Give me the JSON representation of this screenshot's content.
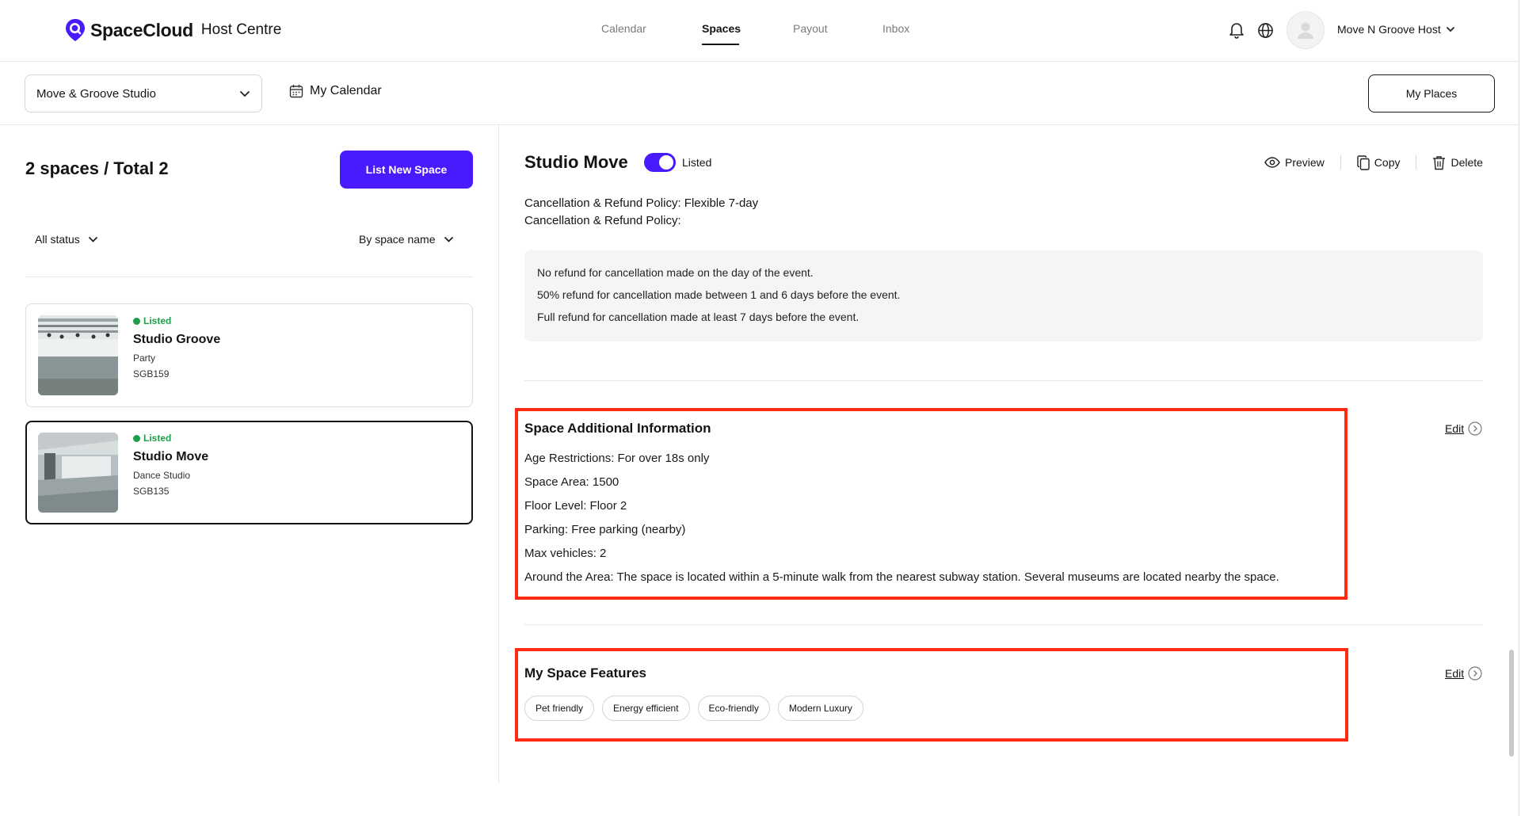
{
  "brand": {
    "name": "SpaceCloud",
    "section": "Host Centre",
    "accent": "#4a1aff"
  },
  "nav": {
    "items": [
      "Calendar",
      "Spaces",
      "Payout",
      "Inbox"
    ],
    "active": "Spaces"
  },
  "user": {
    "name": "Move N Groove Host"
  },
  "subheader": {
    "venue": "Move & Groove Studio",
    "calendar_label": "My Calendar",
    "my_places_label": "My Places"
  },
  "left": {
    "count_label": "2 spaces / Total 2",
    "list_new_label": "List New Space",
    "status_filter": "All status",
    "sort_filter": "By space name",
    "spaces": [
      {
        "status": "Listed",
        "title": "Studio Groove",
        "type": "Party",
        "code": "SGB159"
      },
      {
        "status": "Listed",
        "title": "Studio Move",
        "type": "Dance Studio",
        "code": "SGB135"
      }
    ]
  },
  "detail": {
    "title": "Studio Move",
    "listed_label": "Listed",
    "actions": {
      "preview": "Preview",
      "copy": "Copy",
      "delete": "Delete"
    },
    "policy_line1": "Cancellation & Refund Policy: Flexible 7-day",
    "policy_line2": "Cancellation & Refund Policy:",
    "policy_items": [
      "No refund for cancellation made on the day of the event.",
      "50% refund for cancellation made between 1 and 6 days before the event.",
      "Full refund for cancellation made at least 7 days before the event."
    ],
    "additional": {
      "title": "Space Additional Information",
      "edit_label": "Edit",
      "lines": [
        "Age Restrictions: For over 18s only",
        "Space Area: 1500",
        "Floor Level: Floor 2",
        "Parking: Free parking (nearby)",
        "Max vehicles: 2",
        "Around the Area: The space is located within a 5-minute walk from the nearest subway station. Several museums are located nearby the space."
      ]
    },
    "features": {
      "title": "My Space Features",
      "edit_label": "Edit",
      "chips": [
        "Pet friendly",
        "Energy efficient",
        "Eco-friendly",
        "Modern Luxury"
      ]
    }
  },
  "highlight_color": "#ff2a12",
  "status_color": "#1e9e4a"
}
